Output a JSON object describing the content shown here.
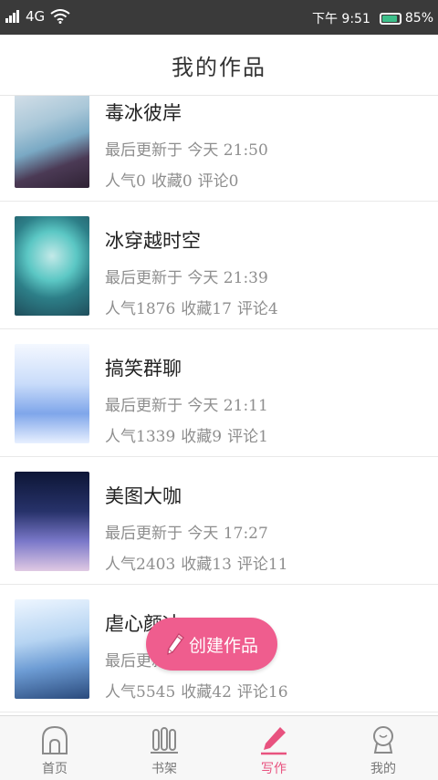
{
  "status": {
    "network": "4G",
    "time": "下午 9:51",
    "battery": "85%",
    "battery_level": 0.85
  },
  "header": {
    "title": "我的作品"
  },
  "works": [
    {
      "title": "毒冰彼岸",
      "updated": "最后更新于 今天 21:50",
      "popularity": "人气0",
      "favorites": "收藏0",
      "comments": "评论0"
    },
    {
      "title": "冰穿越时空",
      "updated": "最后更新于 今天 21:39",
      "popularity": "人气1876",
      "favorites": "收藏17",
      "comments": "评论4"
    },
    {
      "title": "搞笑群聊",
      "updated": "最后更新于 今天 21:11",
      "popularity": "人气1339",
      "favorites": "收藏9",
      "comments": "评论1"
    },
    {
      "title": "美图大咖",
      "updated": "最后更新于 今天 17:27",
      "popularity": "人气2403",
      "favorites": "收藏13",
      "comments": "评论11"
    },
    {
      "title": "虐心颜冰",
      "updated": "最后更新于 今天 17:11",
      "popularity": "人气5545",
      "favorites": "收藏42",
      "comments": "评论16"
    }
  ],
  "fab": {
    "label": "创建作品",
    "icon": "pencil-icon"
  },
  "nav": [
    {
      "label": "首页",
      "icon": "home-icon"
    },
    {
      "label": "书架",
      "icon": "bookshelf-icon"
    },
    {
      "label": "写作",
      "icon": "write-icon",
      "active": true
    },
    {
      "label": "我的",
      "icon": "profile-icon"
    }
  ],
  "colors": {
    "accent": "#ef5d8e",
    "status_bar": "#3a3a3a",
    "text_secondary": "#8e8e8e"
  }
}
